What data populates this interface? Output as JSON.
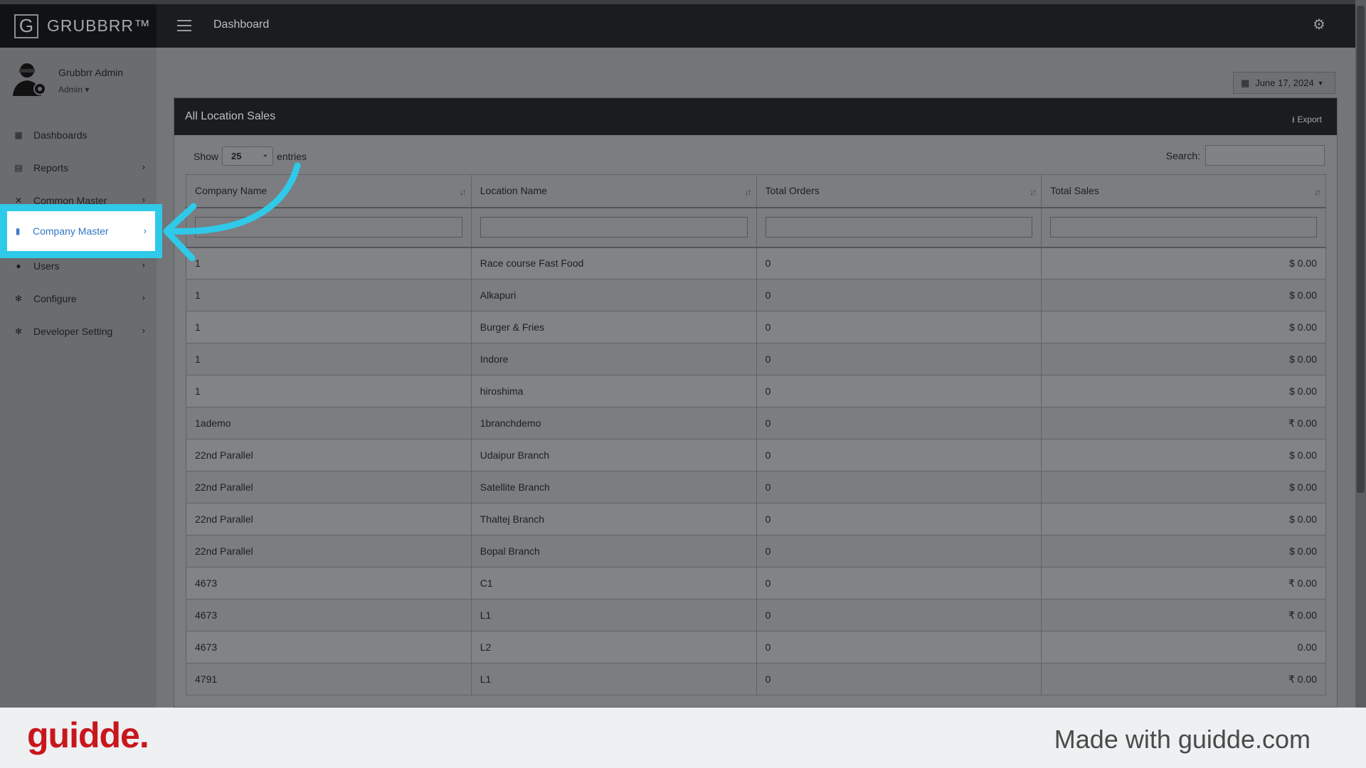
{
  "header": {
    "brand_letter": "G",
    "brand_name": "GRUBBRR™",
    "page_title": "Dashboard",
    "menu_icon": "hamburger-icon",
    "settings_icon": "gear-icon"
  },
  "profile": {
    "name": "Grubbrr Admin",
    "role": "Admin ▾"
  },
  "sidebar": {
    "items": [
      {
        "label": "Dashboards",
        "icon": "dashboard-icon",
        "glyph": "▦",
        "chevron": ""
      },
      {
        "label": "Reports",
        "icon": "report-icon",
        "glyph": "▤",
        "chevron": "›"
      },
      {
        "label": "Common Master",
        "icon": "tools-icon",
        "glyph": "✕",
        "chevron": "›"
      },
      {
        "label": "Company Master",
        "icon": "building-icon",
        "glyph": "▮",
        "chevron": "›"
      },
      {
        "label": "Users",
        "icon": "user-add-icon",
        "glyph": "●",
        "chevron": "›"
      },
      {
        "label": "Configure",
        "icon": "gear-icon",
        "glyph": "✻",
        "chevron": "›"
      },
      {
        "label": "Developer Setting",
        "icon": "gear-icon",
        "glyph": "✻",
        "chevron": "›"
      }
    ]
  },
  "date_picker": {
    "value": "June 17, 2024",
    "icon": "calendar-icon"
  },
  "panel": {
    "title": "All Location Sales",
    "export_label": "Export",
    "show_label": "Show",
    "entries_value": "25",
    "entries_label": "entries",
    "search_label": "Search:"
  },
  "table": {
    "columns": [
      "Company Name",
      "Location Name",
      "Total Orders",
      "Total Sales"
    ],
    "rows": [
      [
        "1",
        "Race course Fast Food",
        "0",
        "$ 0.00"
      ],
      [
        "1",
        "Alkapuri",
        "0",
        "$ 0.00"
      ],
      [
        "1",
        "Burger & Fries",
        "0",
        "$ 0.00"
      ],
      [
        "1",
        "Indore",
        "0",
        "$ 0.00"
      ],
      [
        "1",
        "hiroshima",
        "0",
        "$ 0.00"
      ],
      [
        "1ademo",
        "1branchdemo",
        "0",
        "₹ 0.00"
      ],
      [
        "22nd Parallel",
        "Udaipur Branch",
        "0",
        "$ 0.00"
      ],
      [
        "22nd Parallel",
        "Satellite Branch",
        "0",
        "$ 0.00"
      ],
      [
        "22nd Parallel",
        "Thaltej Branch",
        "0",
        "$ 0.00"
      ],
      [
        "22nd Parallel",
        "Bopal Branch",
        "0",
        "$ 0.00"
      ],
      [
        "4673",
        "C1",
        "0",
        "₹ 0.00"
      ],
      [
        "4673",
        "L1",
        "0",
        "₹ 0.00"
      ],
      [
        "4673",
        "L2",
        "0",
        "0.00"
      ],
      [
        "4791",
        "L1",
        "0",
        "₹ 0.00"
      ]
    ]
  },
  "footer": {
    "logo": "guidde.",
    "made_with": "Made with guidde.com"
  },
  "colors": {
    "highlight": "#2fc9e9",
    "active_link": "#2e78c6",
    "guidde_red": "#c8161d"
  }
}
